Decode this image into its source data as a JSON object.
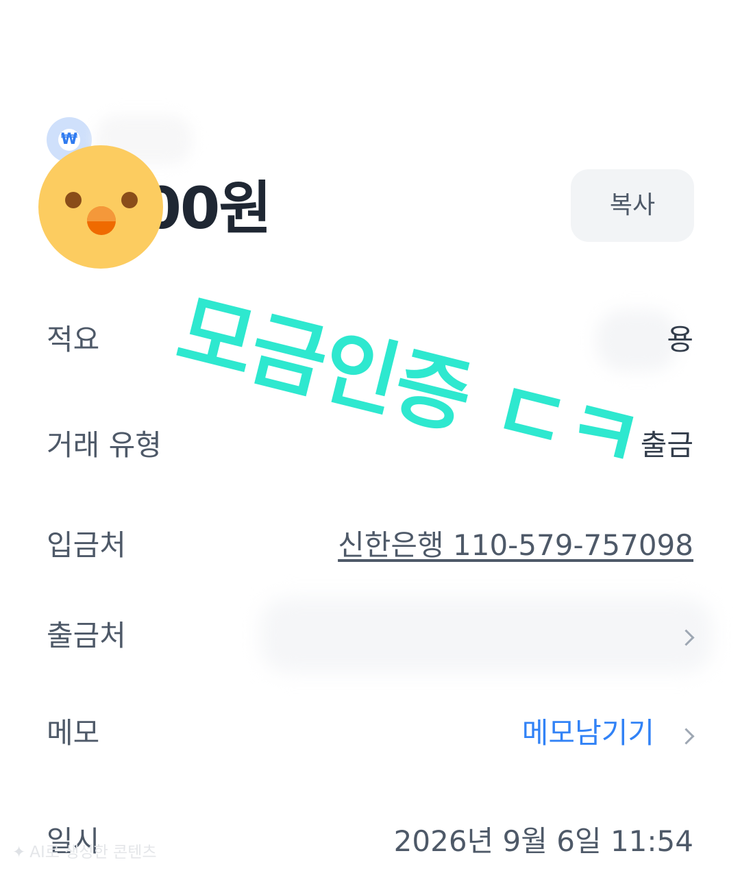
{
  "header": {
    "currency_icon": "won-icon",
    "currency_glyph": "₩",
    "amount": "000원",
    "copy_label": "복사"
  },
  "details": {
    "summary_label": "적요",
    "summary_value": "용",
    "type_label": "거래 유형",
    "type_value": "출금",
    "deposit_label": "입금처",
    "deposit_value": "신한은행 110-579-757098",
    "withdraw_label": "출금처",
    "memo_label": "메모",
    "memo_value": "메모남기기",
    "date_label": "일시",
    "date_value": "2026년 9월 6일 11:54"
  },
  "overlay": {
    "watermark_text": "모금인증 ㄷㅋ",
    "ai_label": "AI로 생성한 콘텐츠",
    "ai_icon": "sparkle-icon",
    "sticker_icon": "chick-face-icon"
  },
  "colors": {
    "accent_blue": "#3182f6",
    "watermark": "#2ee8cf",
    "chick_yellow": "#fccc60"
  }
}
